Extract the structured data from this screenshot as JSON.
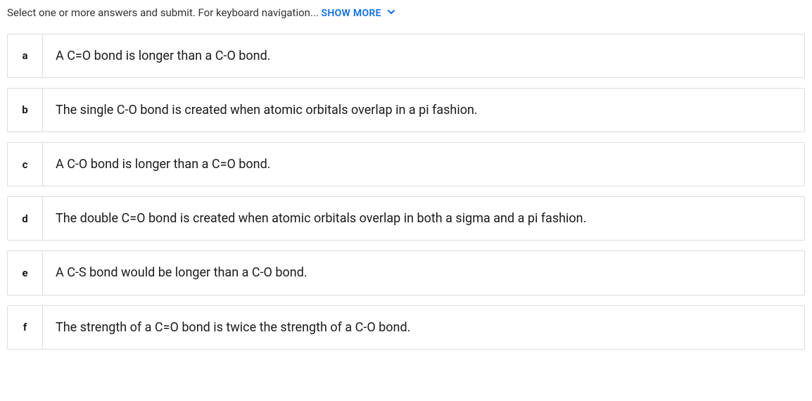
{
  "instructions": {
    "text": "Select one or more answers and submit. For keyboard navigation... ",
    "show_more": "SHOW MORE"
  },
  "options": [
    {
      "letter": "a",
      "text": "A C=O bond is longer than a C-O bond."
    },
    {
      "letter": "b",
      "text": "The single C-O bond is created when atomic orbitals overlap in a pi fashion."
    },
    {
      "letter": "c",
      "text": "A C-O bond is longer than a C=O bond."
    },
    {
      "letter": "d",
      "text": "The double C=O bond is created when atomic orbitals overlap in both a sigma and a pi fashion."
    },
    {
      "letter": "e",
      "text": "A C-S bond would be longer than a C-O bond."
    },
    {
      "letter": "f",
      "text": "The strength of a C=O bond is twice the strength of a C-O bond."
    }
  ]
}
